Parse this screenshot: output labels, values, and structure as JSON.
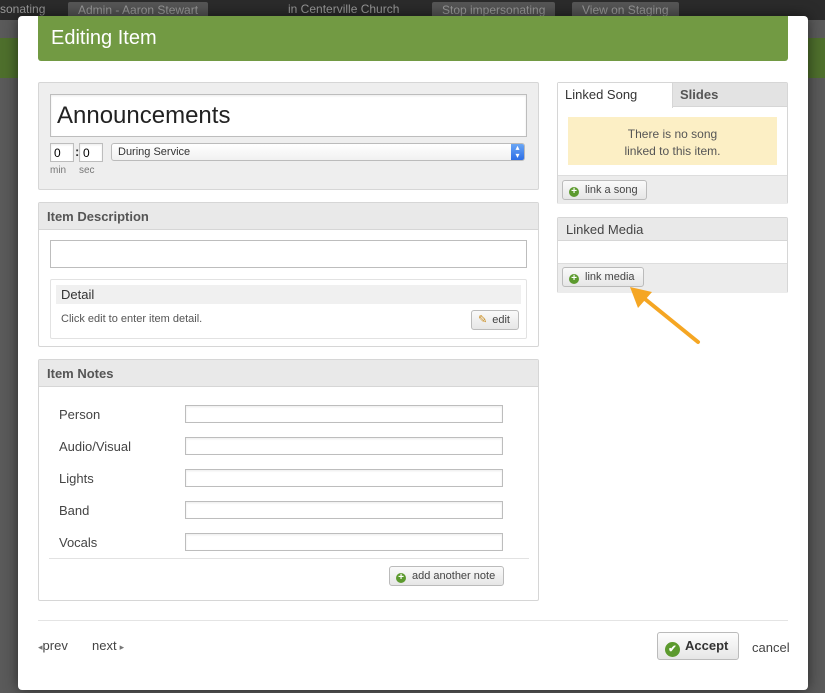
{
  "background": {
    "topbar": {
      "impersonating_text": "sonating",
      "admin_label": "Admin - Aaron Stewart",
      "church_label": "in Centerville Church",
      "stop_impersonating": "Stop impersonating",
      "view_on_staging": "View on Staging"
    }
  },
  "modal": {
    "title": "Editing Item",
    "item": {
      "name_value": "Announcements",
      "minutes_value": "0",
      "seconds_value": "0",
      "min_label": "min",
      "sec_label": "sec",
      "time_colon": ":",
      "timing_selected": "During Service"
    },
    "description": {
      "title": "Item Description",
      "value": "",
      "detail_title": "Detail",
      "detail_text": "Click edit to enter item detail.",
      "edit_label": "edit"
    },
    "notes": {
      "title": "Item Notes",
      "rows": [
        {
          "label": "Person",
          "value": ""
        },
        {
          "label": "Audio/Visual",
          "value": ""
        },
        {
          "label": "Lights",
          "value": ""
        },
        {
          "label": "Band",
          "value": ""
        },
        {
          "label": "Vocals",
          "value": ""
        }
      ],
      "add_label": "add another note"
    },
    "linked_song": {
      "tabs": [
        "Linked Song",
        "Slides"
      ],
      "active_tab": "Linked Song",
      "empty_message_line1": "There is no song",
      "empty_message_line2": "linked to this item.",
      "link_label": "link a song"
    },
    "linked_media": {
      "title": "Linked Media",
      "link_label": "link media"
    },
    "footer": {
      "prev_label": "prev",
      "next_label": "next",
      "accept_label": "Accept",
      "cancel_label": "cancel"
    }
  },
  "colors": {
    "header_green": "#729a43",
    "accept_check": "#5c9a2e",
    "notice_bg": "#fcefc5",
    "annotation_arrow": "#f5a623"
  }
}
